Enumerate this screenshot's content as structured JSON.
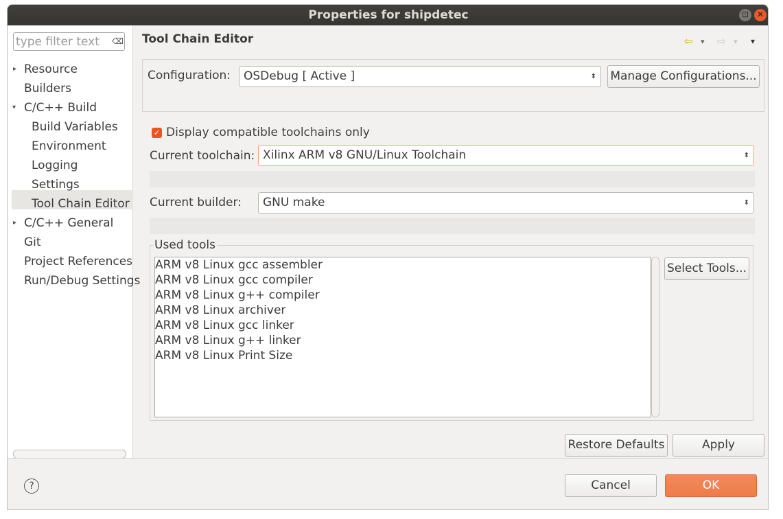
{
  "window": {
    "title": "Properties for shipdetec",
    "maximize_glyph": "⊡",
    "close_glyph": "✕"
  },
  "filter": {
    "placeholder": "type filter text",
    "clear_glyph": "⌫"
  },
  "tree": {
    "items": [
      {
        "label": "Resource",
        "expandable": true
      },
      {
        "label": "Builders"
      },
      {
        "label": "C/C++ Build",
        "expanded": true
      },
      {
        "label": "Build Variables"
      },
      {
        "label": "Environment"
      },
      {
        "label": "Logging"
      },
      {
        "label": "Settings"
      },
      {
        "label": "Tool Chain Editor",
        "selected": true
      },
      {
        "label": "C/C++ General",
        "expandable": true
      },
      {
        "label": "Git"
      },
      {
        "label": "Project References"
      },
      {
        "label": "Run/Debug Settings"
      }
    ],
    "collapsed_arrow": "▸",
    "expanded_arrow": "▾"
  },
  "page": {
    "title": "Tool Chain Editor",
    "back_glyph": "⇦",
    "forward_glyph": "⇨",
    "dropdown_glyph": "▾"
  },
  "configuration": {
    "label": "Configuration:",
    "value": "OSDebug  [ Active ]",
    "manage_button": "Manage Configurations..."
  },
  "compatible_only": {
    "label": "Display compatible toolchains only",
    "checked": true,
    "check_glyph": "✓"
  },
  "toolchain": {
    "label": "Current toolchain:",
    "value": "Xilinx ARM v8 GNU/Linux Toolchain"
  },
  "builder": {
    "label": "Current builder:",
    "value": "GNU make"
  },
  "used_tools": {
    "legend": "Used tools",
    "items": [
      "ARM v8 Linux gcc assembler",
      "ARM v8 Linux gcc compiler",
      "ARM v8 Linux g++ compiler",
      "ARM v8 Linux archiver",
      "ARM v8 Linux gcc linker",
      "ARM v8 Linux g++ linker",
      "ARM v8 Linux Print Size"
    ],
    "select_button": "Select Tools..."
  },
  "actions": {
    "restore_defaults": "Restore Defaults",
    "apply": "Apply",
    "cancel": "Cancel",
    "ok": "OK"
  },
  "help_glyph": "?",
  "colors": {
    "accent": "#e95420",
    "titlebar": "#3c3b37",
    "focus_border": "#f0a080"
  }
}
